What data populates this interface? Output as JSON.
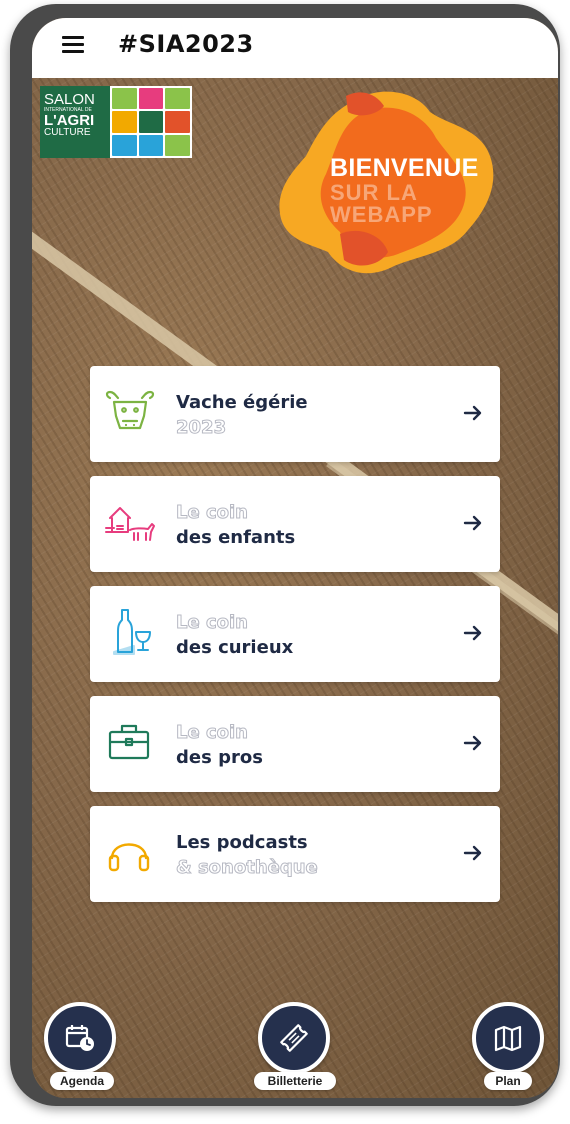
{
  "header": {
    "title": "#SIA2023",
    "menu_icon": "hamburger-menu-icon"
  },
  "logo": {
    "line1": "SALON",
    "line2": "INTERNATIONAL DE",
    "line3": "L'AGRI",
    "line4": "CULTURE"
  },
  "welcome": {
    "line1": "BIENVENUE",
    "line2": "SUR LA",
    "line3": "WEBAPP",
    "colors": {
      "blob_back": "#f7a823",
      "blob_front": "#f26b1d",
      "blob_dark": "#e2522a"
    }
  },
  "cards": [
    {
      "icon": "cow-icon",
      "line1": "Vache égérie",
      "line2": "2023",
      "icon_color": "#7cb342"
    },
    {
      "icon": "farm-goat-icon",
      "line1": "Le coin",
      "line2": "des enfants",
      "icon_color": "#e73c7e"
    },
    {
      "icon": "wine-cheese-icon",
      "line1": "Le coin",
      "line2": "des curieux",
      "icon_color": "#29a3d9"
    },
    {
      "icon": "briefcase-icon",
      "line1": "Le coin",
      "line2": "des pros",
      "icon_color": "#1f7a5a"
    },
    {
      "icon": "headphones-icon",
      "line1": "Les podcasts",
      "line2": "& sonothèque",
      "icon_color": "#f2a900"
    }
  ],
  "bottom_nav": {
    "agenda": {
      "label": "Agenda",
      "icon": "calendar-clock-icon"
    },
    "billetterie": {
      "label": "Billetterie",
      "icon": "ticket-icon"
    },
    "plan": {
      "label": "Plan",
      "icon": "map-icon"
    }
  },
  "colors": {
    "card_text_dark": "#1f2a44",
    "nav_button": "#25304d",
    "logo_green": "#1f6b45"
  }
}
